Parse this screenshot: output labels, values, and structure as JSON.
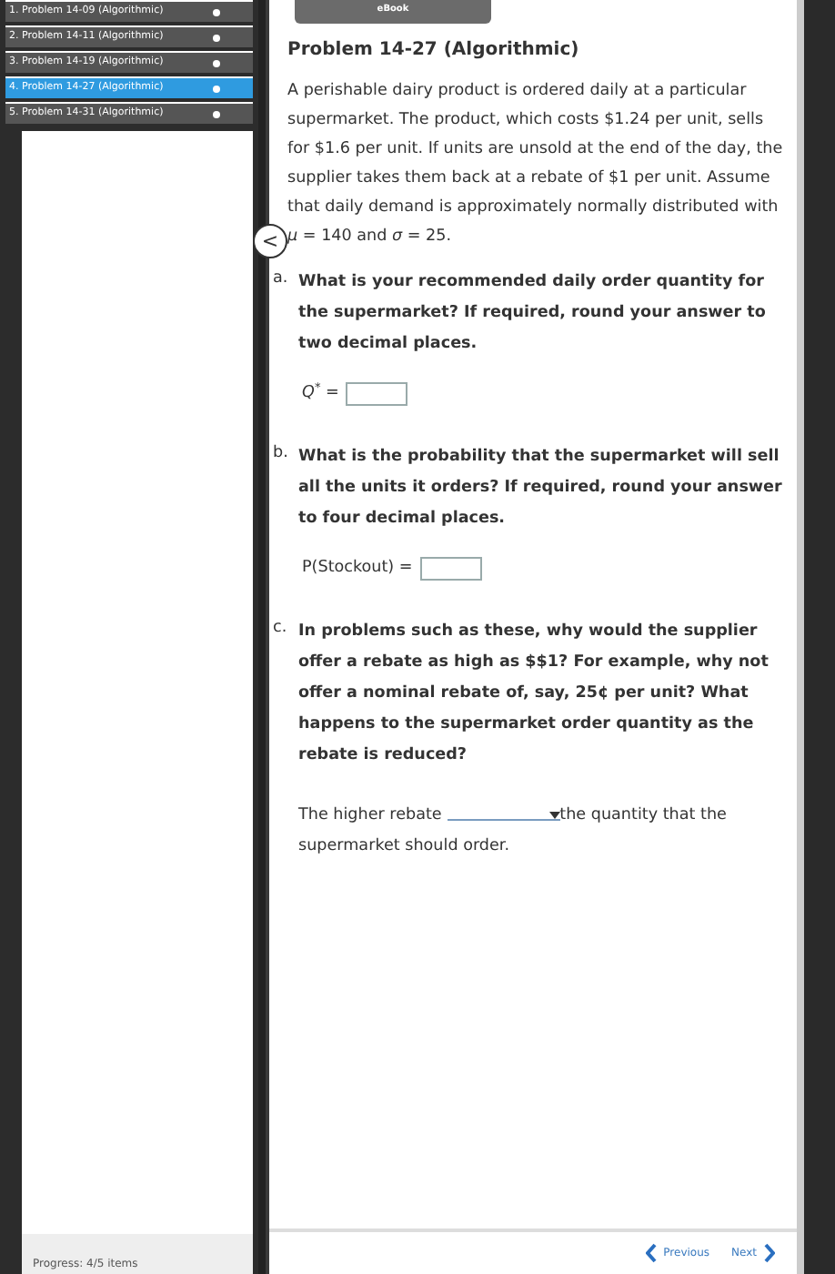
{
  "sidebar": {
    "items": [
      {
        "label": "1. Problem 14-09 (Algorithmic)",
        "selected": false
      },
      {
        "label": "2. Problem 14-11 (Algorithmic)",
        "selected": false
      },
      {
        "label": "3. Problem 14-19 (Algorithmic)",
        "selected": false
      },
      {
        "label": "4. Problem 14-27 (Algorithmic)",
        "selected": true
      },
      {
        "label": "5. Problem 14-31 (Algorithmic)",
        "selected": false
      }
    ],
    "progress": "Progress:  4/5 items"
  },
  "ebook_button": "eBook",
  "back_button": "<",
  "problem": {
    "title": "Problem 14-27 (Algorithmic)",
    "intro": "A perishable dairy product is ordered daily at a particular supermarket. The product, which costs $1.24 per unit, sells for $1.6 per unit. If units are unsold at the end of the day, the supplier takes them back at a rebate of $1 per unit. Assume that daily demand is approximately normally distributed with *μ* = 140 and *σ* = 25.",
    "questions": [
      {
        "letter": "a.",
        "text": "What is your recommended daily order quantity for the supermarket? If required, round your answer to two decimal places.",
        "kind": "input",
        "label": "*Q*$^{*}$ ="
      },
      {
        "letter": "b.",
        "text": "What is the probability that the supermarket will sell all the units it orders? If required, round your answer to four decimal places.",
        "kind": "input",
        "label": "P(Stockout) ="
      },
      {
        "letter": "c.",
        "text": "In problems such as these, why would the supplier offer a rebate as high as $$1? For example, why not offer a nominal rebate of, say, 25¢ per unit? What happens to the supermarket order quantity as the rebate is reduced?",
        "kind": "select",
        "before": "The higher rebate",
        "after": "the quantity that the supermarket should order."
      }
    ]
  },
  "nav": {
    "previous": "Previous",
    "next": "Next"
  }
}
